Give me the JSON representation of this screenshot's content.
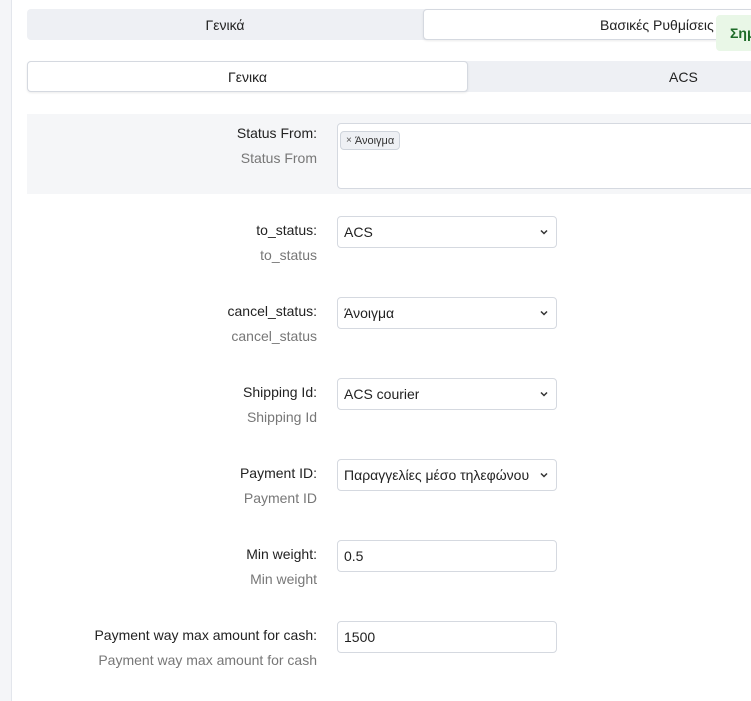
{
  "tabs_top": [
    {
      "label": "Γενικά",
      "active": false
    },
    {
      "label": "Βασικές Ρυθμίσεις",
      "active": true
    }
  ],
  "notice": "Σημ",
  "tabs_sub": [
    {
      "label": "Γενικα",
      "active": true
    },
    {
      "label": "ACS",
      "active": false
    }
  ],
  "form": {
    "status_from": {
      "label": "Status From:",
      "desc": "Status From",
      "tags": [
        "Άνοιγμα"
      ],
      "tag_remove": "×"
    },
    "to_status": {
      "label": "to_status:",
      "desc": "to_status",
      "value": "ACS"
    },
    "cancel_status": {
      "label": "cancel_status:",
      "desc": "cancel_status",
      "value": "Άνοιγμα"
    },
    "shipping_id": {
      "label": "Shipping Id:",
      "desc": "Shipping Id",
      "value": "ACS courier"
    },
    "payment_id": {
      "label": "Payment ID:",
      "desc": "Payment ID",
      "value": "Παραγγελίες μέσο τηλεφώνου"
    },
    "min_weight": {
      "label": "Min weight:",
      "desc": "Min weight",
      "value": "0.5"
    },
    "max_cash": {
      "label": "Payment way max amount for cash:",
      "desc": "Payment way max amount for cash",
      "value": "1500"
    }
  }
}
